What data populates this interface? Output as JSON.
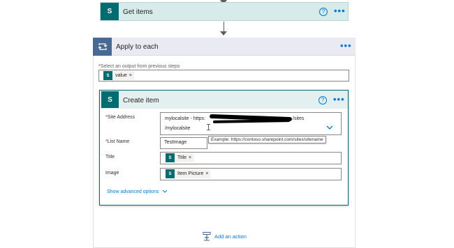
{
  "get_items": {
    "title": "Get items",
    "tile_letter": "S"
  },
  "apply_to_each": {
    "title": "Apply to each",
    "select_label": "Select an output from previous steps",
    "select_required": "*",
    "value_token": "value"
  },
  "create_item": {
    "title": "Create item",
    "tile_letter": "S",
    "site_address": {
      "label": "Site Address",
      "line1_prefix": "mylocalsite - https:",
      "line1_suffix": "/sites",
      "line2": "/mylocalsite"
    },
    "list_name": {
      "label": "List Name",
      "value": "TestImage"
    },
    "title_field": {
      "label": "Title",
      "token": "Title"
    },
    "image_field": {
      "label": "Image",
      "token": "Item Picture"
    },
    "required_marker": "*",
    "tooltip": "Example: https://contoso.sharepoint.com/sites/sitename",
    "advanced_options": "Show advanced options"
  },
  "add_action": {
    "label": "Add an action"
  },
  "icons": {
    "help": "?",
    "more": "•••",
    "remove": "×",
    "chevron": "chevron-down-icon",
    "sp_token_letter": "S"
  },
  "colors": {
    "sharepoint": "#036c70",
    "apply_tile": "#486991",
    "link": "#0078d4"
  }
}
